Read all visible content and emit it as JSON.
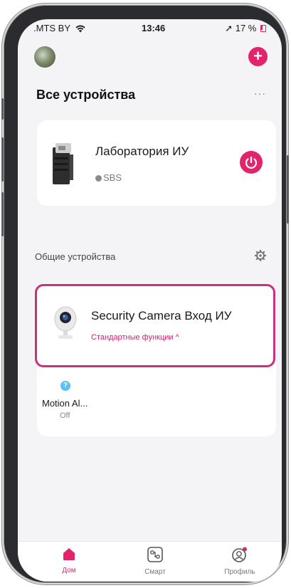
{
  "status_bar": {
    "carrier": ".MTS BY",
    "time": "13:46",
    "battery": "17 %"
  },
  "header": {
    "add_label": "+"
  },
  "all_devices": {
    "title": "Все устройства",
    "more_label": "···"
  },
  "devices": [
    {
      "name": "Лаборатория ИУ",
      "status": "SBS"
    }
  ],
  "shared": {
    "title": "Общие устройства",
    "camera": {
      "name": "Security Camera Вход ИУ",
      "functions": "Стандартные функции ^"
    },
    "sensor": {
      "help": "?",
      "name": "Motion Al...",
      "state": "Off"
    }
  },
  "tabs": [
    {
      "label": "Дом"
    },
    {
      "label": "Смарт"
    },
    {
      "label": "Профиль"
    }
  ],
  "colors": {
    "accent": "#e2246d",
    "highlight_border": "#c9307f",
    "background": "#f4f4f6",
    "card": "#ffffff",
    "help": "#5bc1f0"
  },
  "icons": [
    "wifi-icon",
    "location-arrow-icon",
    "battery-icon",
    "plus-icon",
    "more-icon",
    "power-icon",
    "gear-icon",
    "help-icon",
    "home-icon",
    "smart-icon",
    "profile-icon"
  ]
}
